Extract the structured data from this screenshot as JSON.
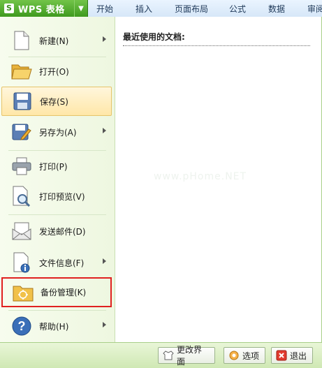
{
  "app": {
    "logo": "S",
    "title": "WPS 表格",
    "dropdown_icon": "triangle-down-icon"
  },
  "tabs": [
    "开始",
    "插入",
    "页面布局",
    "公式",
    "数据",
    "审阅"
  ],
  "menu": {
    "items": [
      {
        "label": "新建(N)",
        "icon": "new-document-icon",
        "has_submenu": true
      },
      {
        "label": "打开(O)",
        "icon": "open-folder-icon",
        "has_submenu": false
      },
      {
        "label": "保存(S)",
        "icon": "save-disk-icon",
        "has_submenu": false
      },
      {
        "label": "另存为(A)",
        "icon": "save-as-icon",
        "has_submenu": true
      },
      {
        "label": "打印(P)",
        "icon": "printer-icon",
        "has_submenu": false
      },
      {
        "label": "打印预览(V)",
        "icon": "print-preview-icon",
        "has_submenu": false
      },
      {
        "label": "发送邮件(D)",
        "icon": "mail-icon",
        "has_submenu": false
      },
      {
        "label": "文件信息(F)",
        "icon": "file-info-icon",
        "has_submenu": true
      },
      {
        "label": "备份管理(K)",
        "icon": "backup-folder-icon",
        "has_submenu": false
      },
      {
        "label": "帮助(H)",
        "icon": "help-icon",
        "has_submenu": true
      }
    ]
  },
  "recent": {
    "title": "最近使用的文档:"
  },
  "watermark": "www.pHome.NET",
  "bottom": {
    "change_ui": "更改界面",
    "options": "选项",
    "exit": "退出"
  },
  "colors": {
    "accent_green": "#3f9a1f",
    "highlight": "#ffe7a8",
    "red_border": "#e02020"
  }
}
